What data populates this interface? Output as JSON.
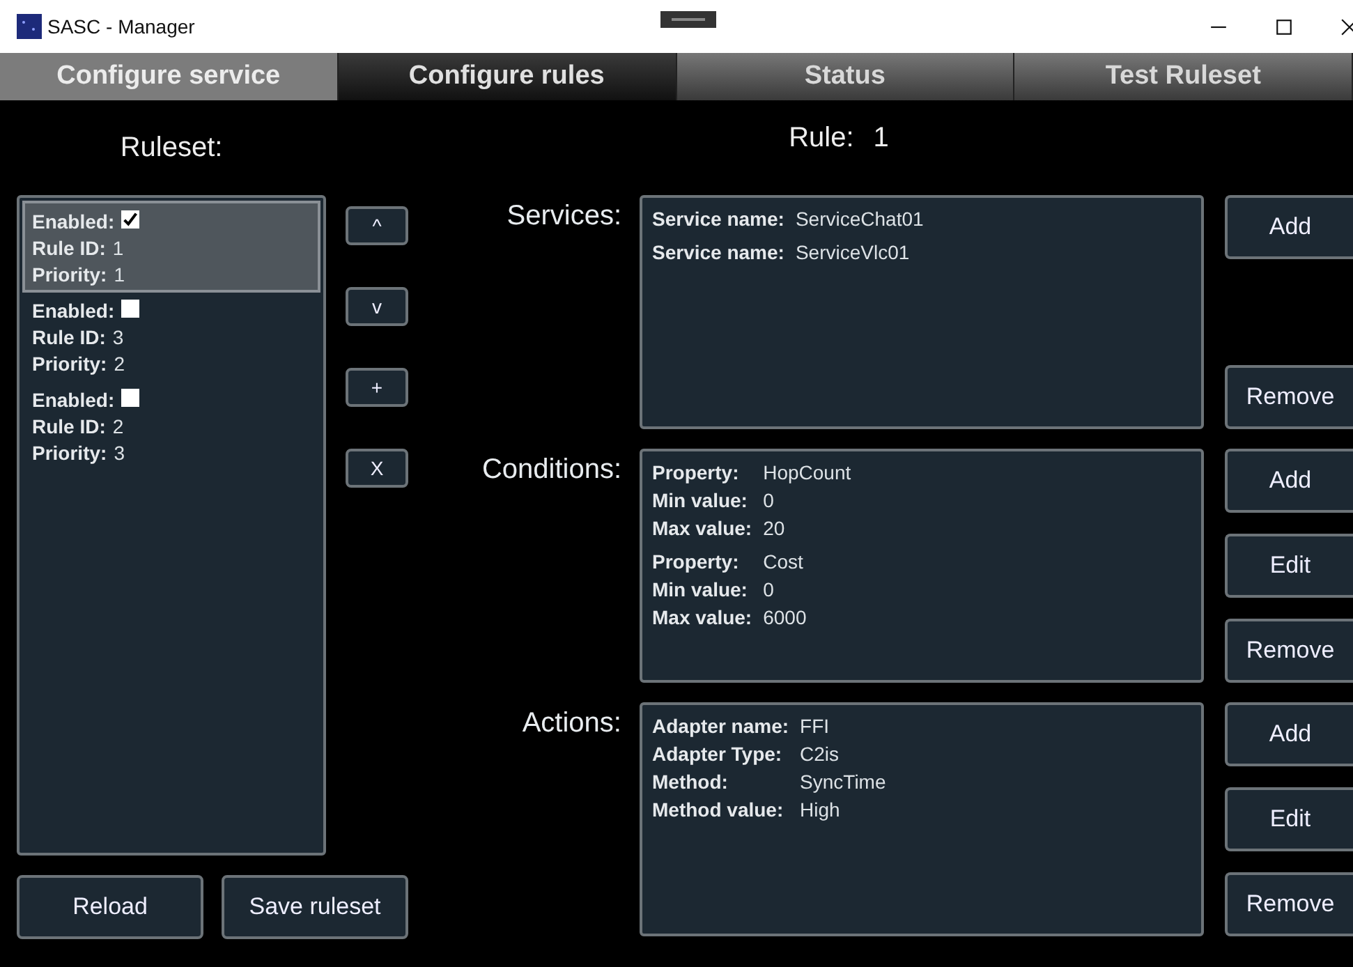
{
  "window": {
    "title": "SASC - Manager"
  },
  "tabs": [
    {
      "label": "Configure service",
      "selected": false,
      "disabled": true
    },
    {
      "label": "Configure rules",
      "selected": true,
      "disabled": false
    },
    {
      "label": "Status",
      "selected": false,
      "disabled": false
    },
    {
      "label": "Test Ruleset",
      "selected": false,
      "disabled": false
    }
  ],
  "ruleset": {
    "heading": "Ruleset:",
    "rules": [
      {
        "selected": true,
        "fields": [
          {
            "label": "Enabled:",
            "kind": "checkbox",
            "checked": true
          },
          {
            "label": "Rule ID:",
            "kind": "text",
            "value": "1"
          },
          {
            "label": "Priority:",
            "kind": "text",
            "value": "1"
          }
        ]
      },
      {
        "selected": false,
        "fields": [
          {
            "label": "Enabled:",
            "kind": "checkbox",
            "checked": false
          },
          {
            "label": "Rule ID:",
            "kind": "text",
            "value": "3"
          },
          {
            "label": "Priority:",
            "kind": "text",
            "value": "2"
          }
        ]
      },
      {
        "selected": false,
        "fields": [
          {
            "label": "Enabled:",
            "kind": "checkbox",
            "checked": false
          },
          {
            "label": "Rule ID:",
            "kind": "text",
            "value": "2"
          },
          {
            "label": "Priority:",
            "kind": "text",
            "value": "3"
          }
        ]
      }
    ],
    "order_buttons": [
      "^",
      "v",
      "+",
      "X"
    ],
    "bottom_buttons": [
      "Reload",
      "Save ruleset"
    ]
  },
  "rule": {
    "label": "Rule:",
    "number": "1",
    "sections": [
      {
        "label": "Services:",
        "buttons": [
          "Add",
          "Remove"
        ],
        "items": [
          {
            "fields": [
              {
                "label": "Service name:",
                "value": "ServiceChat01"
              }
            ]
          },
          {
            "fields": [
              {
                "label": "Service name:",
                "value": "ServiceVlc01"
              }
            ]
          }
        ]
      },
      {
        "label": "Conditions:",
        "buttons": [
          "Add",
          "Edit",
          "Remove"
        ],
        "items": [
          {
            "fields": [
              {
                "label": "Property:",
                "value": "HopCount"
              },
              {
                "label": "Min value:",
                "value": "0"
              },
              {
                "label": "Max value:",
                "value": "20"
              }
            ]
          },
          {
            "fields": [
              {
                "label": "Property:",
                "value": "Cost"
              },
              {
                "label": "Min value:",
                "value": "0"
              },
              {
                "label": "Max value:",
                "value": "6000"
              }
            ]
          }
        ]
      },
      {
        "label": "Actions:",
        "buttons": [
          "Add",
          "Edit",
          "Remove"
        ],
        "items": [
          {
            "fields": [
              {
                "label": "Adapter name:",
                "value": "FFI"
              },
              {
                "label": "Adapter Type:",
                "value": "C2is"
              },
              {
                "label": "Method:",
                "value": "SyncTime"
              },
              {
                "label": "Method value:",
                "value": "High"
              }
            ]
          }
        ]
      }
    ]
  }
}
